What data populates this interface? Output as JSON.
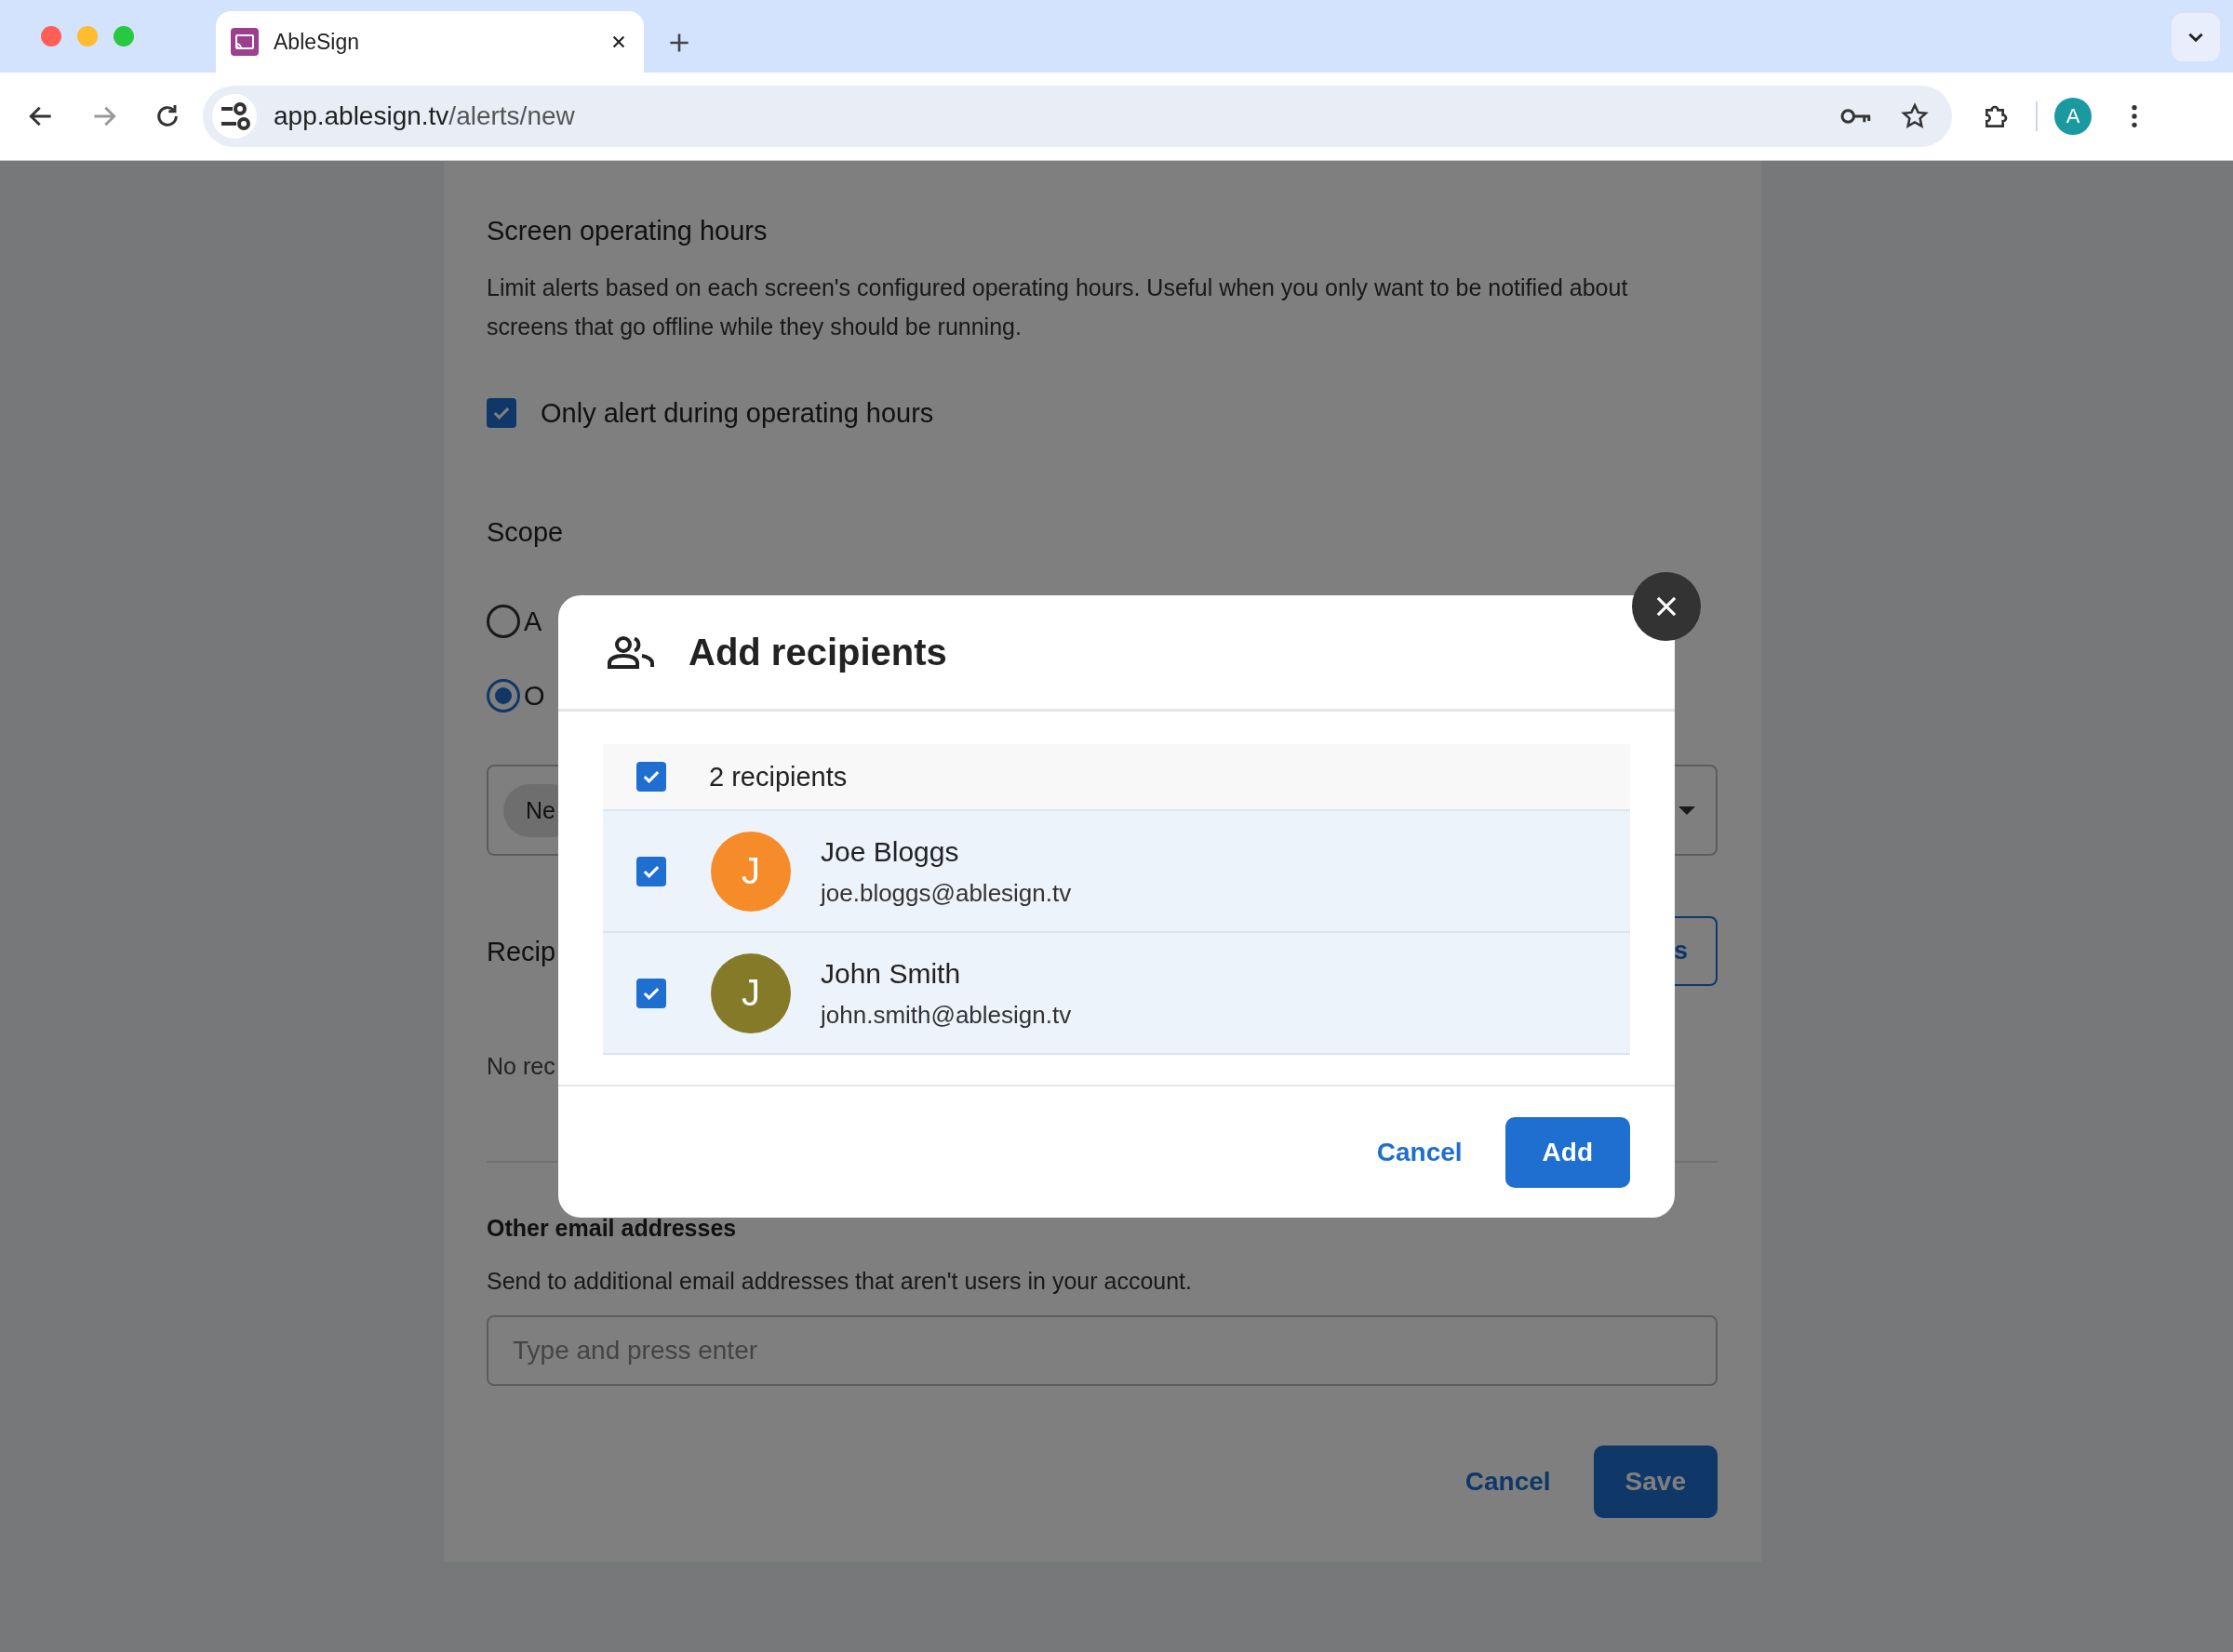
{
  "browser": {
    "tab": {
      "title": "AbleSign"
    },
    "url": {
      "host": "app.ablesign.tv",
      "path": "/alerts/new"
    },
    "profile_initial": "A"
  },
  "page": {
    "operating_hours": {
      "heading": "Screen operating hours",
      "description": "Limit alerts based on each screen's configured operating hours. Useful when you only want to be notified about screens that go offline while they should be running.",
      "checkbox": {
        "label": "Only alert during operating hours",
        "checked": true
      }
    },
    "scope": {
      "heading": "Scope",
      "options": [
        {
          "label": "A",
          "selected": false
        },
        {
          "label": "O",
          "selected": true
        }
      ],
      "chip": "Ne"
    },
    "recipients": {
      "heading": "Recip",
      "button": "s",
      "empty_text": "No rec"
    },
    "other_emails": {
      "heading": "Other email addresses",
      "description": "Send to additional email addresses that aren't users in your account.",
      "placeholder": "Type and press enter"
    },
    "actions": [
      {
        "label": "Cancel",
        "kind": "text"
      },
      {
        "label": "Save",
        "kind": "primary"
      }
    ]
  },
  "dialog": {
    "title": "Add recipients",
    "select_all": {
      "label": "2 recipients",
      "checked": true
    },
    "recipients": [
      {
        "name": "Joe Bloggs",
        "email": "joe.bloggs@ablesign.tv",
        "initial": "J",
        "color": "#f68b2a",
        "checked": true
      },
      {
        "name": "John Smith",
        "email": "john.smith@ablesign.tv",
        "initial": "J",
        "color": "#857a28",
        "checked": true
      }
    ],
    "actions": [
      {
        "label": "Cancel",
        "kind": "text"
      },
      {
        "label": "Add",
        "kind": "primary"
      }
    ]
  }
}
